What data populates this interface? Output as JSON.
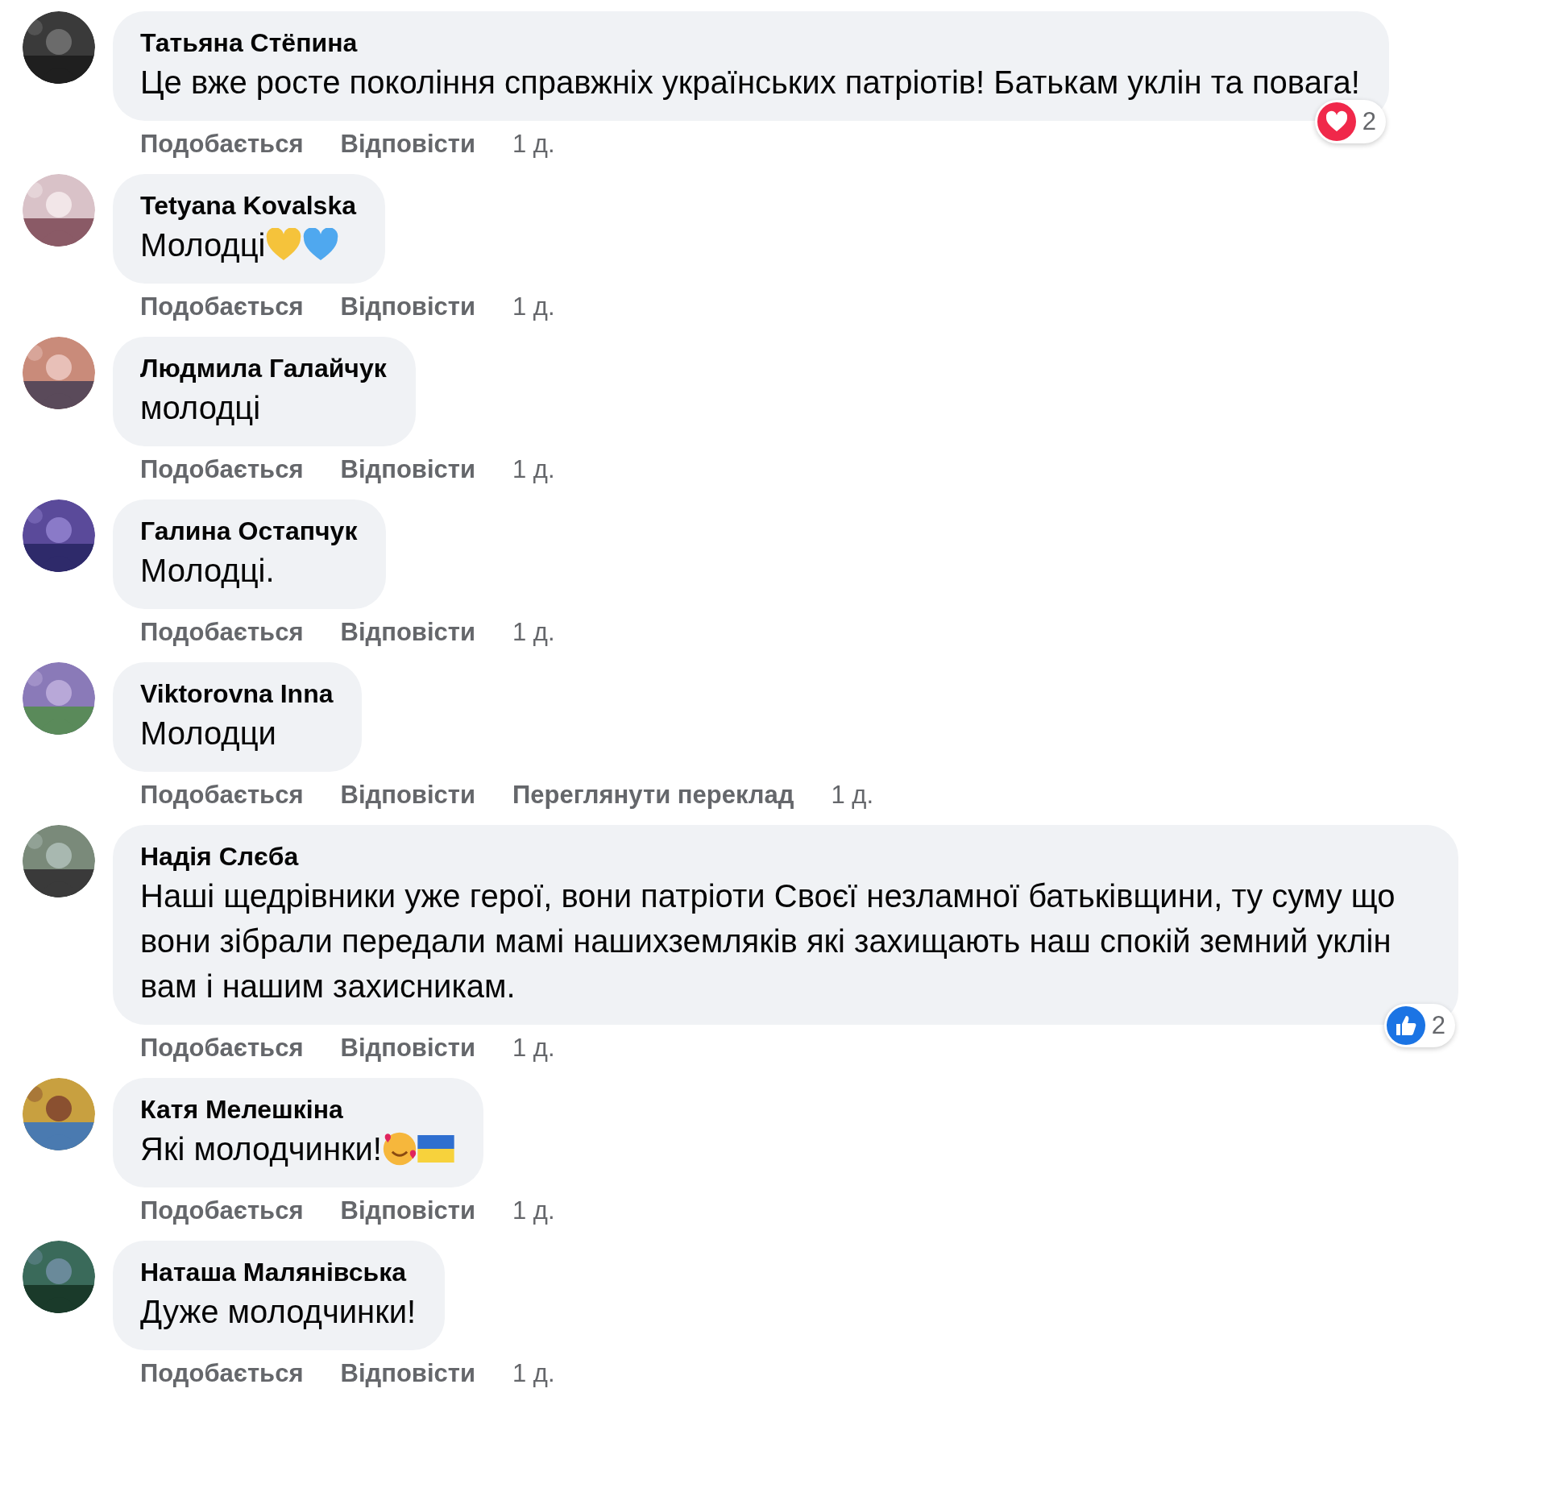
{
  "comments": [
    {
      "author": "Татьяна Стёпина",
      "text": "Це вже росте покоління справжніх українських патріотів! Батькам уклін та повага!",
      "actions": [
        "Подобається",
        "Відповісти"
      ],
      "time": "1 д.",
      "reaction": {
        "kind": "love",
        "count": "2"
      }
    },
    {
      "author": "Tetyana Kovalska",
      "text": "Молодці",
      "emojis": [
        {
          "kind": "heart",
          "color": "#f5c33b"
        },
        {
          "kind": "heart",
          "color": "#4fa8ef"
        }
      ],
      "actions": [
        "Подобається",
        "Відповісти"
      ],
      "time": "1 д."
    },
    {
      "author": "Людмила Галайчук",
      "text": "молодці",
      "actions": [
        "Подобається",
        "Відповісти"
      ],
      "time": "1 д."
    },
    {
      "author": "Галина Остапчук",
      "text": "Молодці.",
      "actions": [
        "Подобається",
        "Відповісти"
      ],
      "time": "1 д."
    },
    {
      "author": "Viktorovna Inna",
      "text": "Молодци",
      "actions": [
        "Подобається",
        "Відповісти",
        "Переглянути переклад"
      ],
      "time": "1 д."
    },
    {
      "author": "Надія Слєба",
      "text": "Наші щедрівники уже герої, вони патріоти Своєї незламної батьківщини, ту суму що вони зібрали передали мамі нашихземляків які захищають наш спокій земний уклін вам і нашим захисникам.",
      "actions": [
        "Подобається",
        "Відповісти"
      ],
      "time": "1 д.",
      "reaction": {
        "kind": "like",
        "count": "2"
      }
    },
    {
      "author": "Катя Мелешкіна",
      "text": "Які молодчинки!",
      "emojis": [
        {
          "kind": "smiling-face"
        },
        {
          "kind": "flag"
        }
      ],
      "actions": [
        "Подобається",
        "Відповісти"
      ],
      "time": "1 д."
    },
    {
      "author": "Наташа Малянівська",
      "text": "Дуже молодчинки!",
      "actions": [
        "Подобається",
        "Відповісти"
      ],
      "time": "1 д."
    }
  ]
}
